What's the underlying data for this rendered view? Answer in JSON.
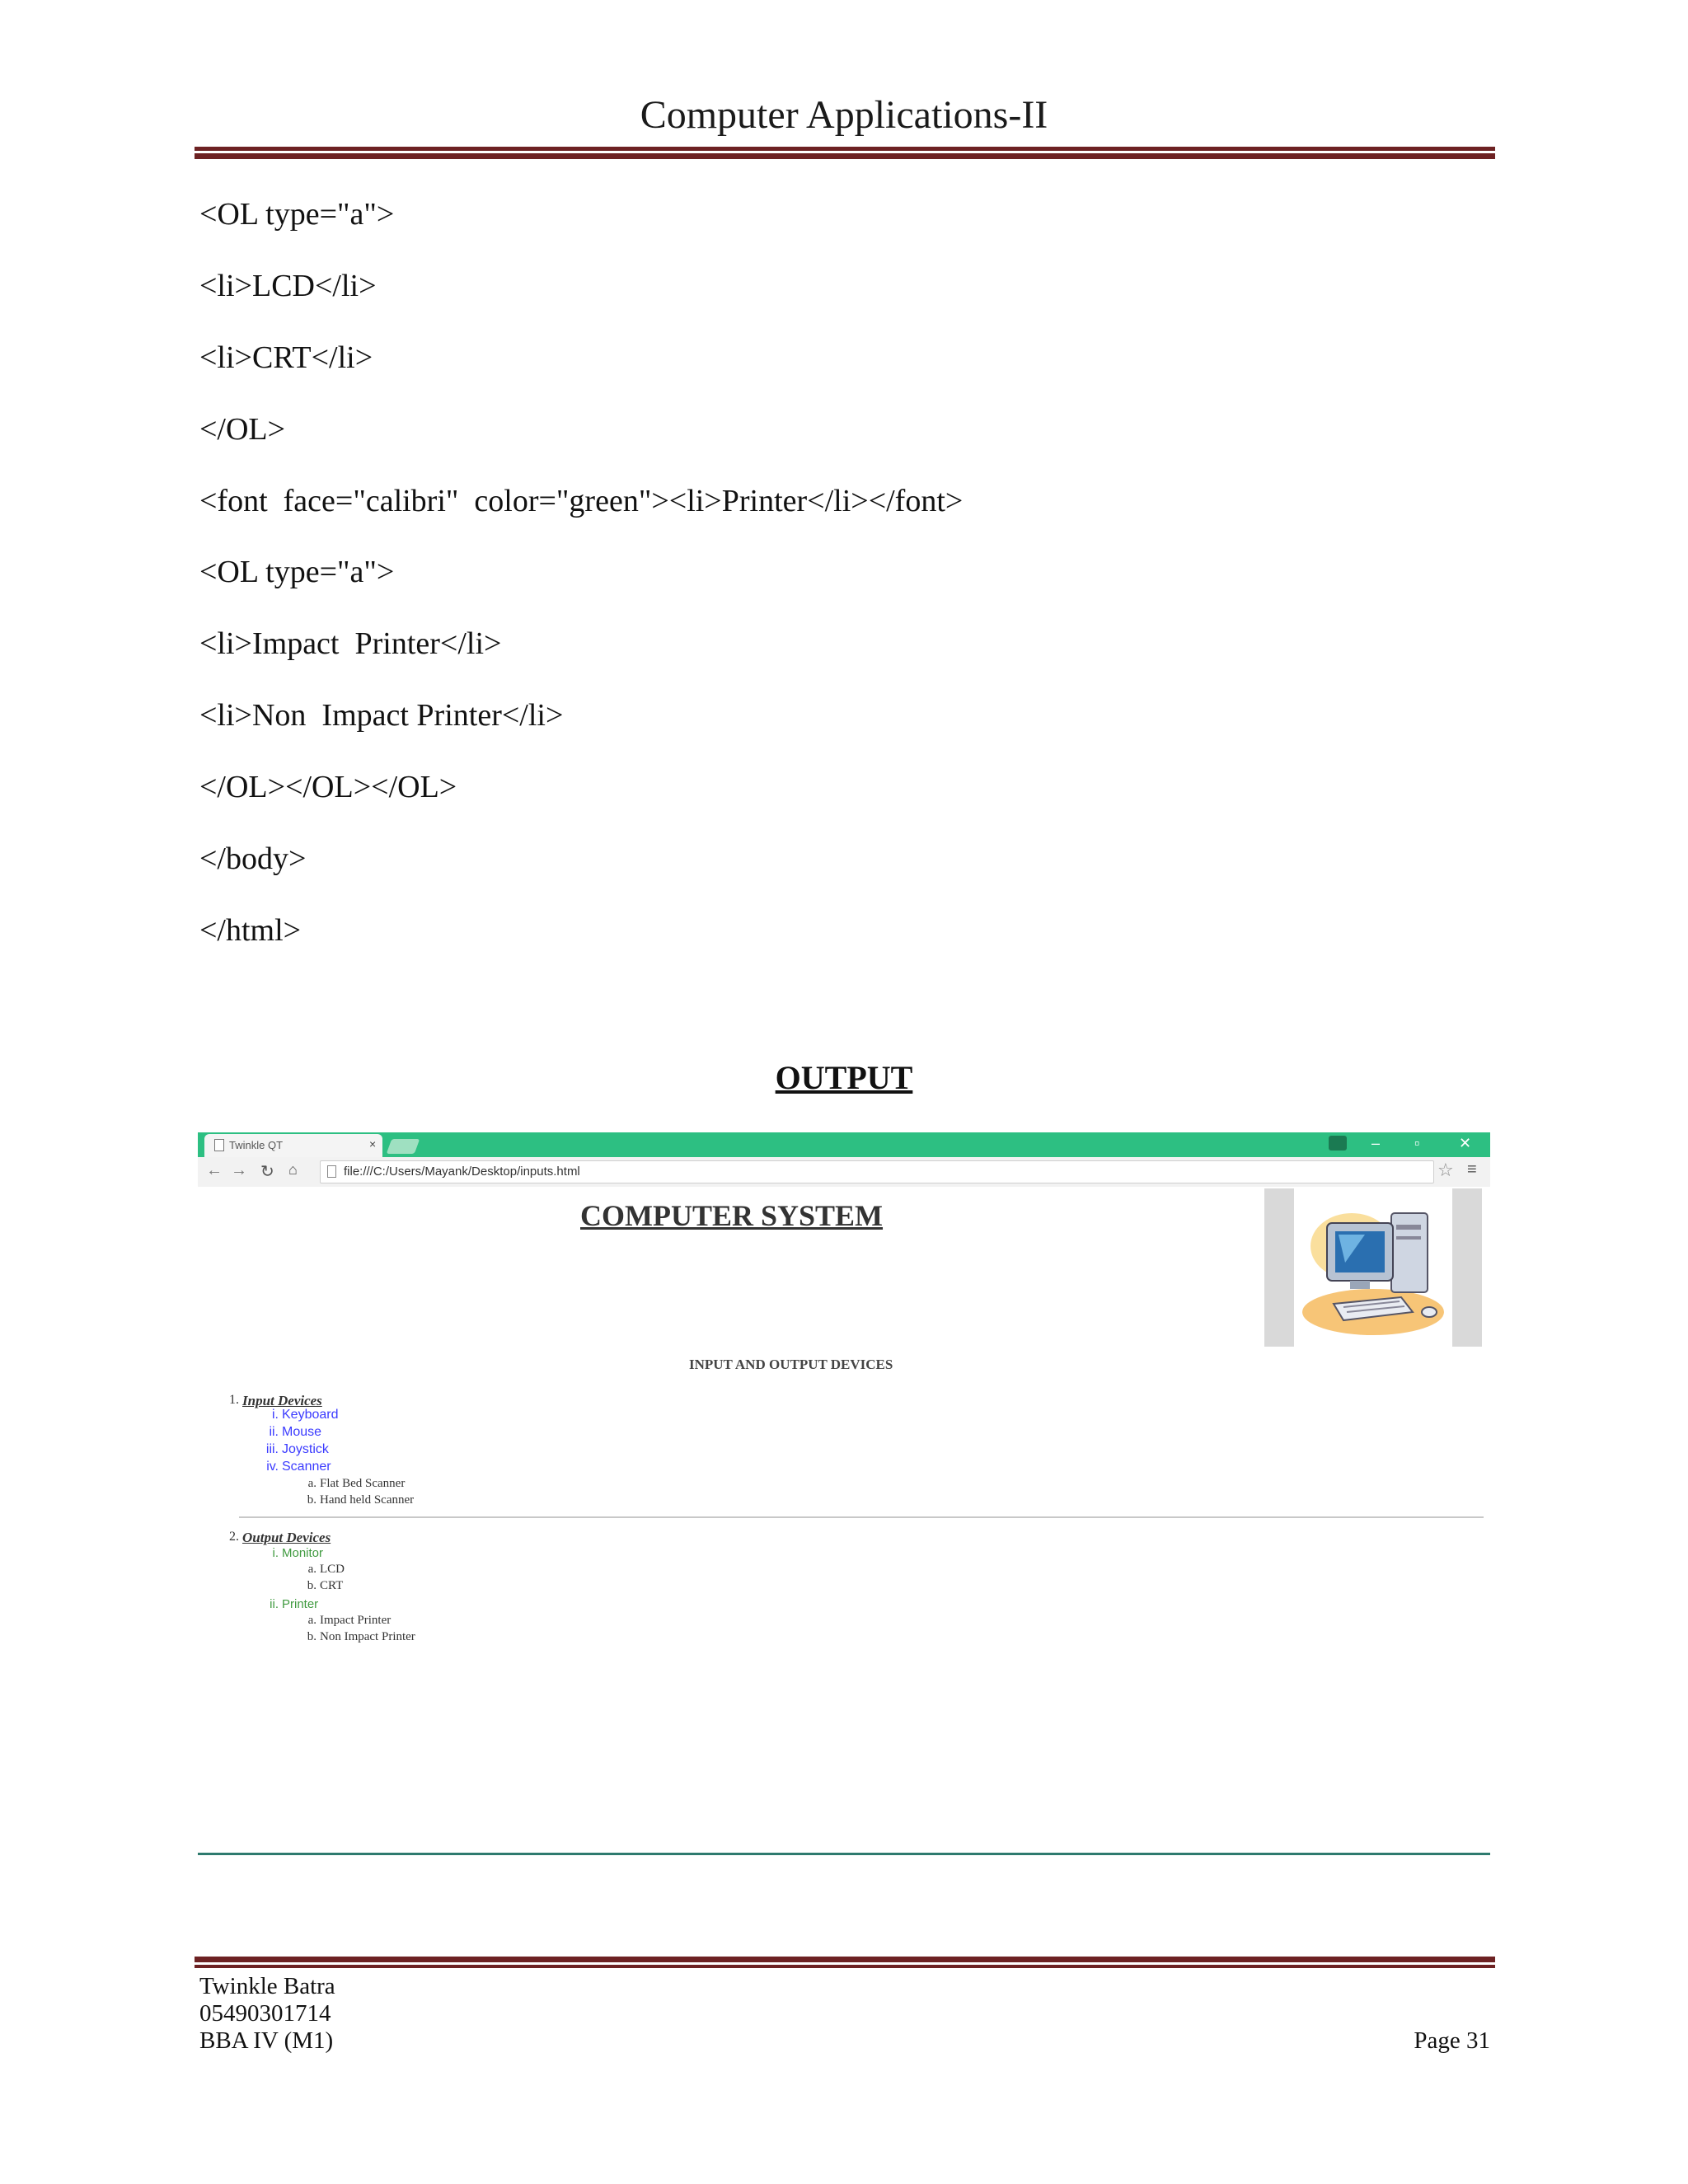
{
  "header": {
    "title": "Computer Applications-II"
  },
  "code_lines": [
    "<OL type=\"a\">",
    "<li>LCD</li>",
    "<li>CRT</li>",
    "</OL>",
    "<font  face=\"calibri\"  color=\"green\"><li>Printer</li></font>",
    "<OL type=\"a\">",
    "<li>Impact  Printer</li>",
    "<li>Non  Impact Printer</li>",
    "</OL></OL></OL>",
    "</body>",
    "</html>"
  ],
  "output_heading": "OUTPUT",
  "browser": {
    "tab_title": "Twinkle QT",
    "tab_close": "×",
    "url": "file:///C:/Users/Mayank/Desktop/inputs.html",
    "page": {
      "title": "COMPUTER SYSTEM",
      "subheading": "INPUT AND OUTPUT DEVICES",
      "input_label": "1.",
      "input_heading": "Input Devices",
      "input_items": [
        {
          "marker": "i.",
          "label": "Keyboard"
        },
        {
          "marker": "ii.",
          "label": "Mouse"
        },
        {
          "marker": "iii.",
          "label": "Joystick"
        },
        {
          "marker": "iv.",
          "label": "Scanner"
        }
      ],
      "scanner_items": [
        {
          "marker": "a.",
          "label": "Flat Bed Scanner"
        },
        {
          "marker": "b.",
          "label": "Hand held Scanner"
        }
      ],
      "output_label": "2.",
      "output_heading": "Output Devices",
      "monitor": {
        "marker": "i.",
        "label": "Monitor"
      },
      "monitor_items": [
        {
          "marker": "a.",
          "label": "LCD"
        },
        {
          "marker": "b.",
          "label": "CRT"
        }
      ],
      "printer": {
        "marker": "ii.",
        "label": "Printer"
      },
      "printer_items": [
        {
          "marker": "a.",
          "label": "Impact Printer"
        },
        {
          "marker": "b.",
          "label": "Non Impact Printer"
        }
      ]
    }
  },
  "footer": {
    "name": "Twinkle Batra",
    "roll": "05490301714",
    "class": "BBA IV (M1)",
    "page": "Page 31"
  },
  "colors": {
    "rule": "#6d2223",
    "browser_accent": "#2dbf82",
    "list_blue": "#3b3bff",
    "list_green": "#3f9a3f"
  }
}
